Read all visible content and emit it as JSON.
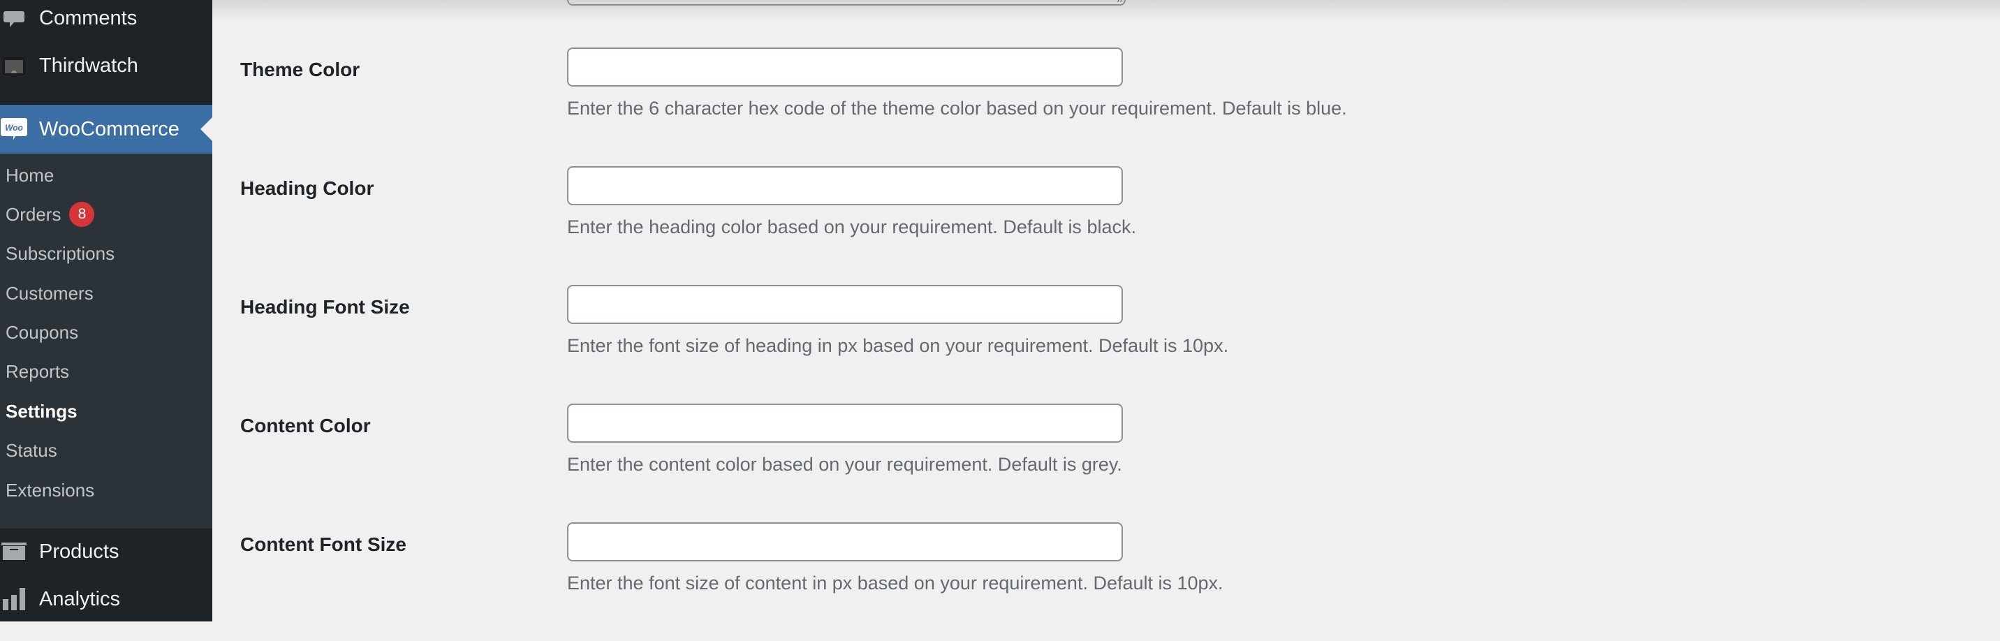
{
  "sidebar": {
    "top_items": [
      {
        "label": "Comments",
        "icon": "comment-bubble-icon"
      },
      {
        "label": "Thirdwatch",
        "icon": "thirdwatch-icon"
      }
    ],
    "active_item": {
      "label": "WooCommerce",
      "icon": "woo-icon",
      "icon_text": "Woo"
    },
    "submenu": [
      {
        "label": "Home"
      },
      {
        "label": "Orders",
        "badge": "8"
      },
      {
        "label": "Subscriptions"
      },
      {
        "label": "Customers"
      },
      {
        "label": "Coupons"
      },
      {
        "label": "Reports"
      },
      {
        "label": "Settings",
        "current": true
      },
      {
        "label": "Status"
      },
      {
        "label": "Extensions"
      }
    ],
    "bottom_items": [
      {
        "label": "Products",
        "icon": "archive-box-icon"
      },
      {
        "label": "Analytics",
        "icon": "bar-chart-icon"
      }
    ]
  },
  "form": {
    "resize_glyph": "//",
    "fields": [
      {
        "label": "Theme Color",
        "value": "",
        "description": "Enter the 6 character hex code of the theme color based on your requirement. Default is blue."
      },
      {
        "label": "Heading Color",
        "value": "",
        "description": "Enter the heading color based on your requirement. Default is black."
      },
      {
        "label": "Heading Font Size",
        "value": "",
        "description": "Enter the font size of heading in px based on your requirement. Default is 10px."
      },
      {
        "label": "Content Color",
        "value": "",
        "description": "Enter the content color based on your requirement. Default is grey."
      },
      {
        "label": "Content Font Size",
        "value": "",
        "description": "Enter the font size of content in px based on your requirement. Default is 10px."
      }
    ]
  },
  "colors": {
    "sidebar_bg": "#1d2327",
    "submenu_bg": "#2c3338",
    "active_bg": "#3a6ea5",
    "badge_bg": "#d63638",
    "page_bg": "#f0f0f1"
  }
}
